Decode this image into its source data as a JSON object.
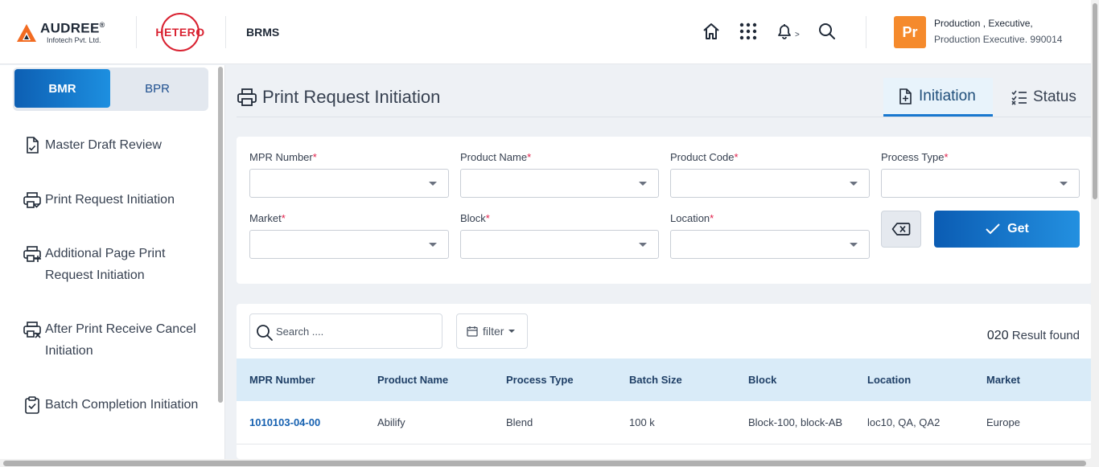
{
  "header": {
    "brand_name": "AUDREE",
    "brand_reg": "®",
    "brand_sub": "Infotech Pvt. Ltd.",
    "client_logo_text": "HETERO",
    "app_name": "BRMS",
    "icons": [
      "home-icon",
      "apps-grid-icon",
      "bell-icon",
      "search-icon"
    ],
    "bell_caret": ">",
    "avatar_initials": "Pr",
    "user_line1": "Production , Executive,",
    "user_line2": "Production Executive. 990014"
  },
  "sidebar": {
    "segments": [
      {
        "label": "BMR",
        "active": true
      },
      {
        "label": "BPR",
        "active": false
      }
    ],
    "items": [
      {
        "label": "Master Draft Review",
        "icon": "document-check-icon"
      },
      {
        "label": "Print Request Initiation",
        "icon": "printer-check-icon"
      },
      {
        "label": "Additional Page Print Request Initiation",
        "icon": "printer-plus-icon"
      },
      {
        "label": "After Print Receive Cancel Initiation",
        "icon": "printer-x-icon"
      },
      {
        "label": "Batch Completion Initiation",
        "icon": "clipboard-check-icon"
      }
    ]
  },
  "main": {
    "title": "Print Request Initiation",
    "tabs": [
      {
        "label": "Initiation",
        "active": true
      },
      {
        "label": "Status",
        "active": false
      }
    ],
    "form": {
      "required_mark": "*",
      "fields": [
        {
          "label": "MPR Number",
          "value": ""
        },
        {
          "label": "Product Name",
          "value": ""
        },
        {
          "label": "Product Code",
          "value": ""
        },
        {
          "label": "Process Type",
          "value": ""
        },
        {
          "label": "Market",
          "value": ""
        },
        {
          "label": "Block",
          "value": ""
        },
        {
          "label": "Location",
          "value": ""
        }
      ],
      "get_label": "Get"
    },
    "table": {
      "search_placeholder": "Search ....",
      "filter_label": "filter",
      "result_count": "020",
      "result_text": "Result found",
      "columns": [
        "MPR Number",
        "Product Name",
        "Process Type",
        "Batch Size",
        "Block",
        "Location",
        "Market"
      ],
      "rows": [
        [
          "1010103-04-00",
          "Abilify",
          "Blend",
          "100 k",
          "Block-100, block-AB",
          "loc10, QA, QA2",
          "Europe"
        ]
      ]
    }
  },
  "colors": {
    "accent": "#1877cf",
    "avatar": "#f58a2c",
    "brand_red": "#d92231",
    "required": "#e11d48"
  }
}
